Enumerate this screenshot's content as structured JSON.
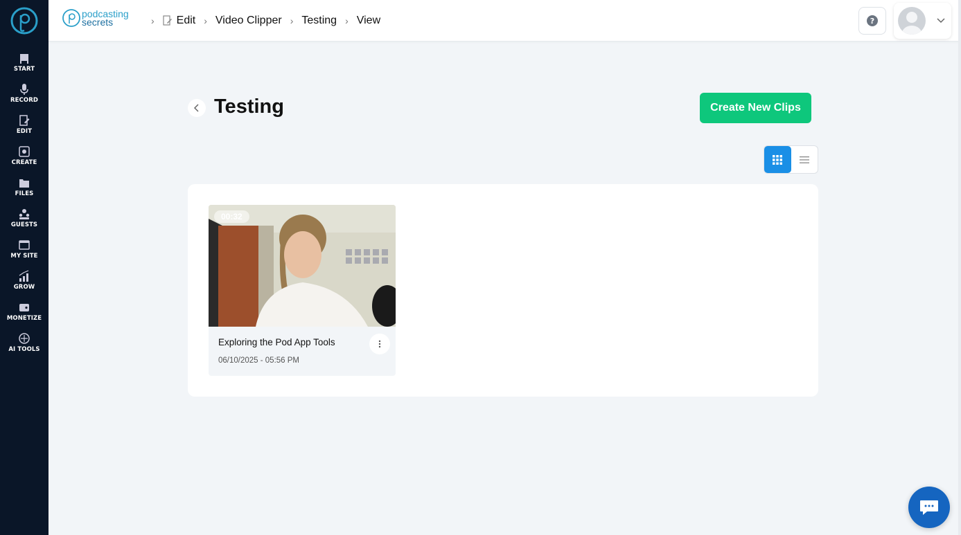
{
  "sidebar": {
    "items": [
      {
        "label": "START",
        "icon": "start-icon"
      },
      {
        "label": "RECORD",
        "icon": "microphone-icon"
      },
      {
        "label": "EDIT",
        "icon": "edit-icon"
      },
      {
        "label": "CREATE",
        "icon": "create-icon"
      },
      {
        "label": "FILES",
        "icon": "files-icon"
      },
      {
        "label": "GUESTS",
        "icon": "guests-icon"
      },
      {
        "label": "MY SITE",
        "icon": "website-icon"
      },
      {
        "label": "GROW",
        "icon": "chart-icon"
      },
      {
        "label": "MONETIZE",
        "icon": "monetize-icon"
      },
      {
        "label": "AI TOOLS",
        "icon": "ai-tools-icon"
      }
    ]
  },
  "header": {
    "brand_line1": "podcasting",
    "brand_line2": "secrets",
    "breadcrumb": [
      "Edit",
      "Video Clipper",
      "Testing",
      "View"
    ]
  },
  "main": {
    "title": "Testing",
    "create_button": "Create New Clips",
    "view_mode": "grid",
    "clips": [
      {
        "duration": "00:32",
        "title": "Exploring the Pod App Tools",
        "date": "06/10/2025 - 05:56 PM"
      }
    ]
  },
  "colors": {
    "sidebar_bg": "#0a1628",
    "accent_green": "#0ec77c",
    "accent_blue": "#1a8fe6",
    "chat_blue": "#1565c0",
    "brand_teal": "#2a9fc9"
  }
}
